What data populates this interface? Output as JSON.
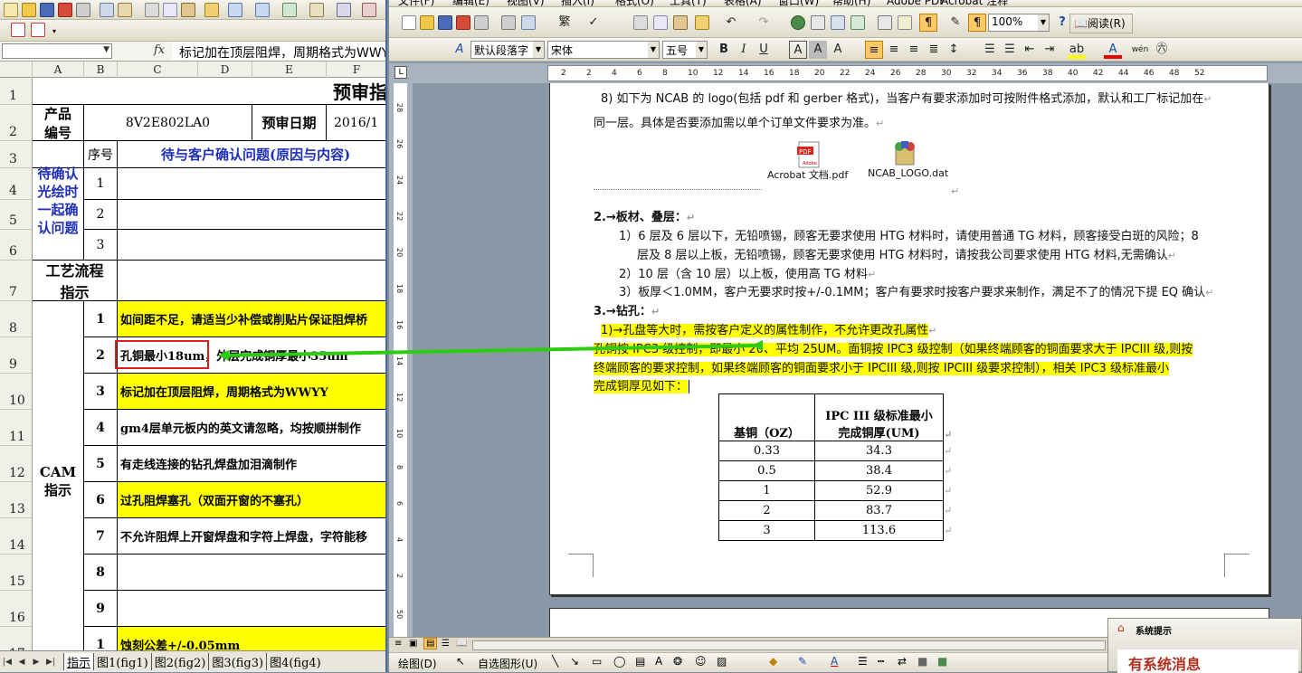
{
  "excel": {
    "formula_bar": {
      "name_box": "",
      "fx": "fx",
      "content": "标记加在顶层阻焊，周期格式为WWYY"
    },
    "columns": [
      "A",
      "B",
      "C",
      "D",
      "E",
      "F"
    ],
    "rows": [
      "1",
      "2",
      "3",
      "4",
      "5",
      "6",
      "7",
      "8",
      "9",
      "10",
      "11",
      "12",
      "13",
      "14",
      "15",
      "16",
      "17"
    ],
    "title": "预审指",
    "product_label": "产品\n编号",
    "product_value": "8V2E802LA0",
    "review_date_label": "预审日期",
    "review_date_value": "2016/1",
    "seq_header": "序号",
    "question_header": "待与客户确认问题(原因与内容)",
    "pending_label": "待确认\n光绘时\n一起确\n认问题",
    "pending_numbers": [
      "1",
      "2",
      "3"
    ],
    "process_label": "工艺流程\n指示",
    "cam_label": "CAM\n指示",
    "cam_items": [
      {
        "no": "1",
        "text": "如间距不足，请适当少补偿或削贴片保证阻焊桥",
        "highlight": true
      },
      {
        "no": "2",
        "text": "孔铜最小18um，外层完成铜厚最小35um",
        "highlight": false
      },
      {
        "no": "3",
        "text": "标记加在顶层阻焊，周期格式为WWYY",
        "highlight": true
      },
      {
        "no": "4",
        "text": "gm4层单元板内的英文请忽略，均按顺拼制作",
        "highlight": false
      },
      {
        "no": "5",
        "text": "有走线连接的钻孔焊盘加泪滴制作",
        "highlight": false
      },
      {
        "no": "6",
        "text": "过孔阻焊塞孔（双面开窗的不塞孔）",
        "highlight": true
      },
      {
        "no": "7",
        "text": "不允许阻焊上开窗焊盘和字符上焊盘，字符能移",
        "highlight": false
      },
      {
        "no": "8",
        "text": "",
        "highlight": false
      },
      {
        "no": "9",
        "text": "",
        "highlight": false
      }
    ],
    "last_row": {
      "no": "1",
      "text": "蚀刻公差+/-0.05mm"
    },
    "sheet_tabs": [
      "指示",
      "图1(fig1)",
      "图2(fig2)",
      "图3(fig3)",
      "图4(fig4)"
    ]
  },
  "word": {
    "menu": [
      "文件(F)",
      "编辑(E)",
      "视图(V)",
      "插入(I)",
      "格式(O)",
      "工具(T)",
      "表格(A)",
      "窗口(W)",
      "帮助(H)",
      "Adobe PDF",
      "Acrobat 注释"
    ],
    "zoom": "100%",
    "reading_button": "阅读(R)",
    "style_box": "默认段落字",
    "font_box": "宋体",
    "size_box": "五号",
    "ruler_numbers": [
      "2",
      "2",
      "4",
      "6",
      "8",
      "10",
      "12",
      "14",
      "16",
      "18",
      "20",
      "22",
      "24",
      "26",
      "28",
      "30",
      "32",
      "34",
      "36",
      "38",
      "40",
      "42",
      "44",
      "46",
      "48",
      "52"
    ],
    "vruler_numbers": [
      "28",
      "26",
      "24",
      "22",
      "20",
      "18",
      "16",
      "14",
      "12",
      "10",
      "8",
      "6",
      "4",
      "2",
      "50"
    ],
    "paragraphs": {
      "p8_line1": "8) 如下为 NCAB 的 logo(包括 pdf 和 gerber 格式)，当客户有要求添加时可按附件格式添加，默认和工厂标记加在",
      "p8_line2": "同一层。具体是否要添加需以单个订单文件要求为准。",
      "attach1": "Acrobat 文档.pdf",
      "attach2": "NCAB_LOGO.dat",
      "h2": "2.→板材、叠层：",
      "p2_1a": "1）6 层及 6 层以下，无铅喷锡，顾客无要求使用 HTG 材料时，请使用普通 TG 材料，顾客接受白斑的风险；8",
      "p2_1b": "层及 8 层以上板，无铅喷锡，顾客无要求使用 HTG 材料时，请按我公司要求使用 HTG 材料,无需确认",
      "p2_2": "2）10 层（含 10 层）以上板，使用高 TG 材料",
      "p2_3": "3）板厚＜1.0MM，客户无要求时按+/-0.1MM；客户有要求时按客户要求来制作，满足不了的情况下提 EQ 确认",
      "h3": "3.→钻孔：",
      "p3_1": "1)→孔盘等大时，需按客户定义的属性制作，不允许更改孔属性",
      "p3_2a": "孔铜按 IPC3 级控制，即最小 20、平均 25UM。面铜按 IPC3 级控制（如果终端顾客的铜面要求大于 IPCIII 级,则按",
      "p3_2b": "终端顾客的要求控制，如果终端顾客的铜面要求小于 IPCIII 级,则按 IPCIII 级要求控制），相关 IPC3 级标准最小",
      "p3_2c": "完成铜厚见如下："
    },
    "table": {
      "headers": [
        "基铜（OZ）",
        "IPC III 级标准最小\n完成铜厚(UM)"
      ],
      "rows": [
        [
          "0.33",
          "34.3"
        ],
        [
          "0.5",
          "38.4"
        ],
        [
          "1",
          "52.9"
        ],
        [
          "2",
          "83.7"
        ],
        [
          "3",
          "113.6"
        ]
      ]
    },
    "drawbar": {
      "draw": "绘图(D)",
      "autoshape": "自选图形(U)"
    }
  },
  "popup": {
    "title": "系统提示",
    "body": "有系统消息"
  },
  "colors": {
    "highlight": "#ffff00",
    "annotation_box": "#e21b1b",
    "arrow": "#2ecc10",
    "blue_text": "#1f2fb8"
  }
}
